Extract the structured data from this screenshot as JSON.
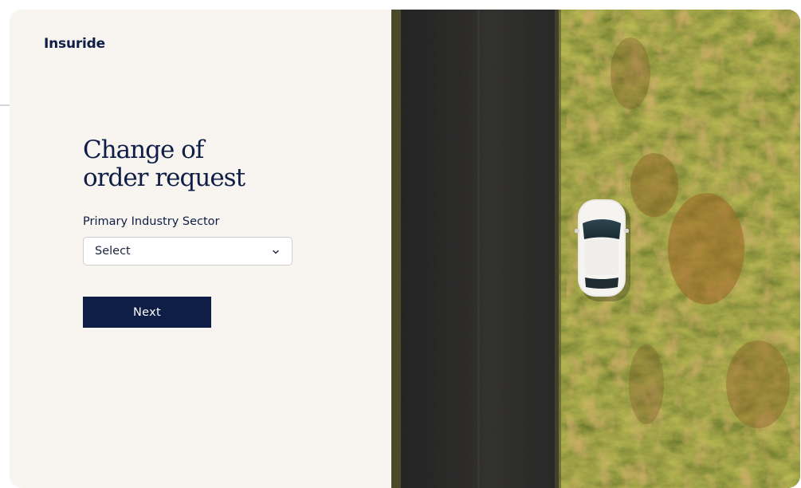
{
  "brand": {
    "name": "Insuride",
    "color": "#0f1e47"
  },
  "form": {
    "title_line1": "Change of",
    "title_line2": "order request",
    "sector_label": "Primary Industry Sector",
    "sector_value": "Select",
    "next_label": "Next"
  },
  "hero_image": {
    "subject": "aerial-road-with-white-car"
  },
  "colors": {
    "background": "#f8f4ef",
    "primary": "#0f1e47",
    "input_border": "#cfcfcf",
    "road": "#2e2d2c",
    "grass": "#3f4f1f",
    "foliage": "#a0692a"
  }
}
